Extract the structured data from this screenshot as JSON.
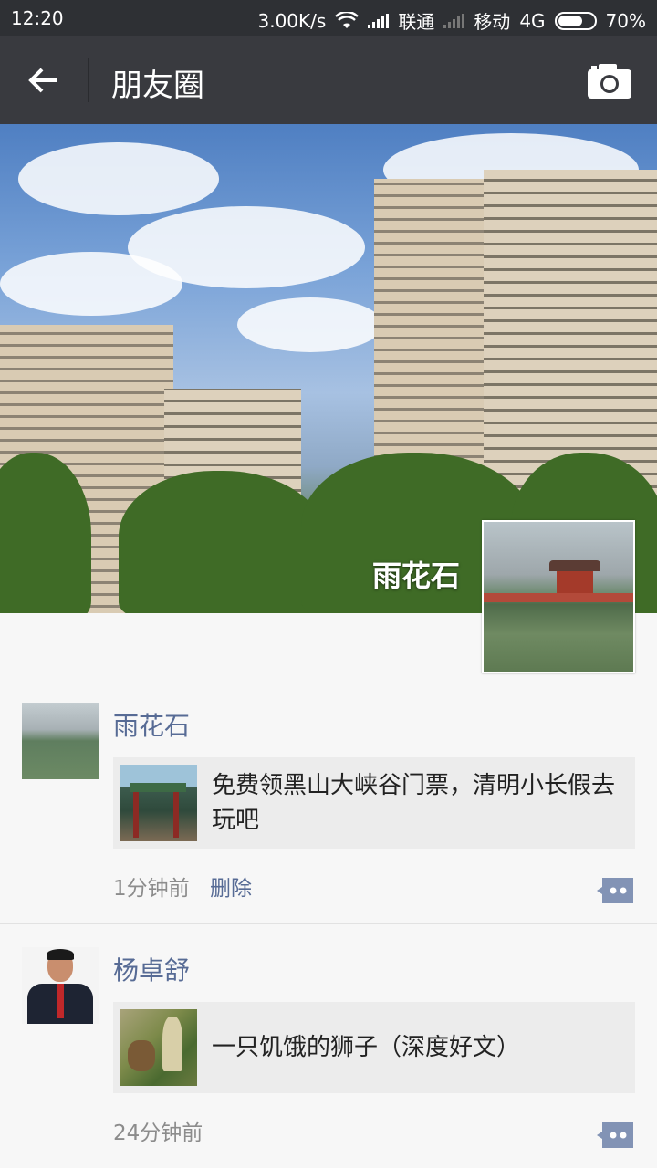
{
  "status_bar": {
    "time": "12:20",
    "net_speed": "3.00K/s",
    "carrier1": "联通",
    "carrier2": "移动",
    "network_type": "4G",
    "battery": "70%",
    "battery_level": 0.7
  },
  "header": {
    "title": "朋友圈",
    "back_icon": "arrow-left-icon",
    "camera_icon": "camera-icon"
  },
  "profile": {
    "name": "雨花石"
  },
  "feed": [
    {
      "user": "雨花石",
      "share_text": "免费领黑山大峡谷门票，清明小长假去玩吧",
      "time": "1分钟前",
      "delete_label": "删除"
    },
    {
      "user": "杨卓舒",
      "share_text": "一只饥饿的狮子（深度好文）",
      "time": "24分钟前"
    }
  ],
  "colors": {
    "title_bar": "#393a3f",
    "status_bar": "#2e3034",
    "link": "#576b95",
    "background": "#f7f7f7"
  }
}
